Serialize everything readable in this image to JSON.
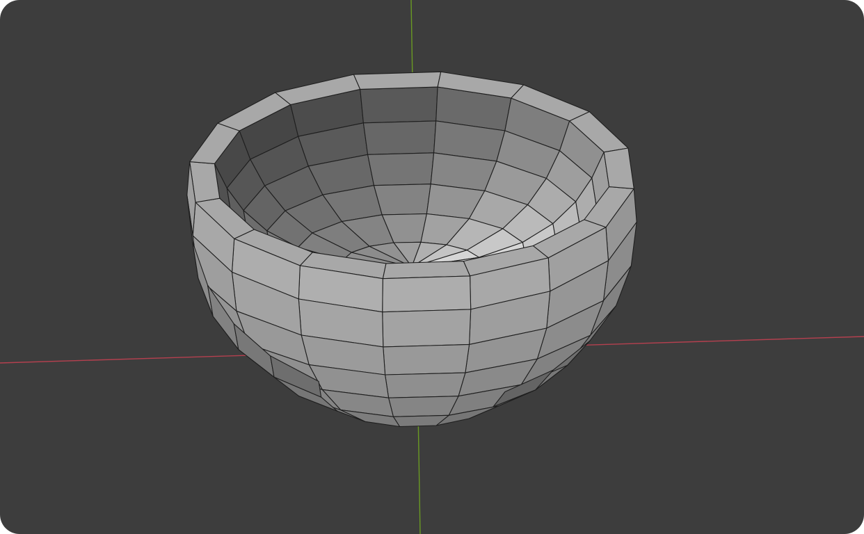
{
  "viewport": {
    "background_color": "#3d3d3d",
    "x_axis_color": "#b5404f",
    "y_axis_color": "#6a9a23"
  },
  "object": {
    "description_icon": "bowl-mesh",
    "mode": "object-wireframe-overlay",
    "face_color": "#9c9c9c",
    "edge_color": "#1e1e1e"
  }
}
